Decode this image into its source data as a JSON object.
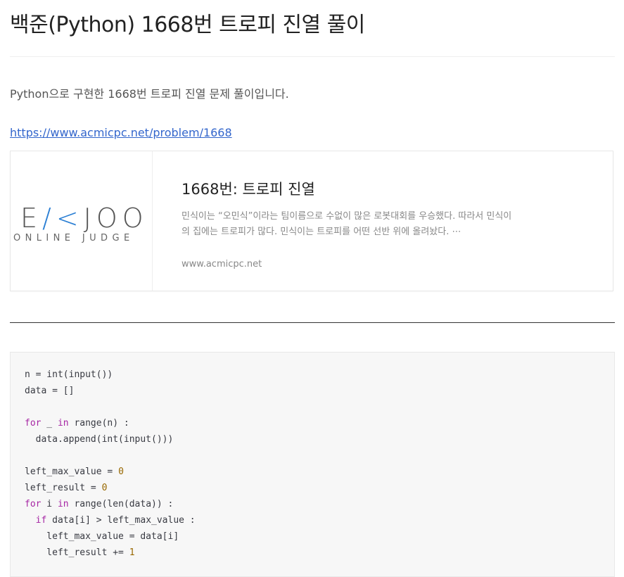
{
  "post": {
    "title": "백준(Python) 1668번 트로피 진열 풀이",
    "intro": "Python으로 구현한 1668번 트로피 진열 문제 풀이입니다.",
    "link": "https://www.acmicpc.net/problem/1668"
  },
  "card": {
    "logo_top_prefix": "E",
    "logo_top_accent": "/<",
    "logo_top_suffix": "JOO",
    "logo_bottom": "ONLINE JUDGE",
    "title": "1668번: 트로피 진열",
    "description": "민식이는 “오민식”이라는 팀이름으로 수없이 많은 로봇대회를 우승했다. 따라서 민식이의 집에는 트로피가 많다. 민식이는 트로피를 어떤 선반 위에 올려놨다. ⋯",
    "domain": "www.acmicpc.net"
  },
  "colors": {
    "keyword": "#a626a4",
    "number": "#986801",
    "link": "#3366cc",
    "logo_accent": "#2b7fd4"
  },
  "code": {
    "l1": "n = int(input())",
    "l2": "data = []",
    "l4_kw": "for",
    "l4_a": " _ ",
    "l4_kw2": "in",
    "l4_b": " range(n) :",
    "l5": "  data.append(int(input()))",
    "l7_a": "left_max_value = ",
    "l7_n": "0",
    "l8_a": "left_result = ",
    "l8_n": "0",
    "l9_kw": "for",
    "l9_a": " i ",
    "l9_kw2": "in",
    "l9_b": " range(len(data)) :",
    "l10_indent": "  ",
    "l10_kw": "if",
    "l10_b": " data[i] > left_max_value :",
    "l11": "    left_max_value = data[i]",
    "l12_a": "    left_result += ",
    "l12_n": "1"
  }
}
